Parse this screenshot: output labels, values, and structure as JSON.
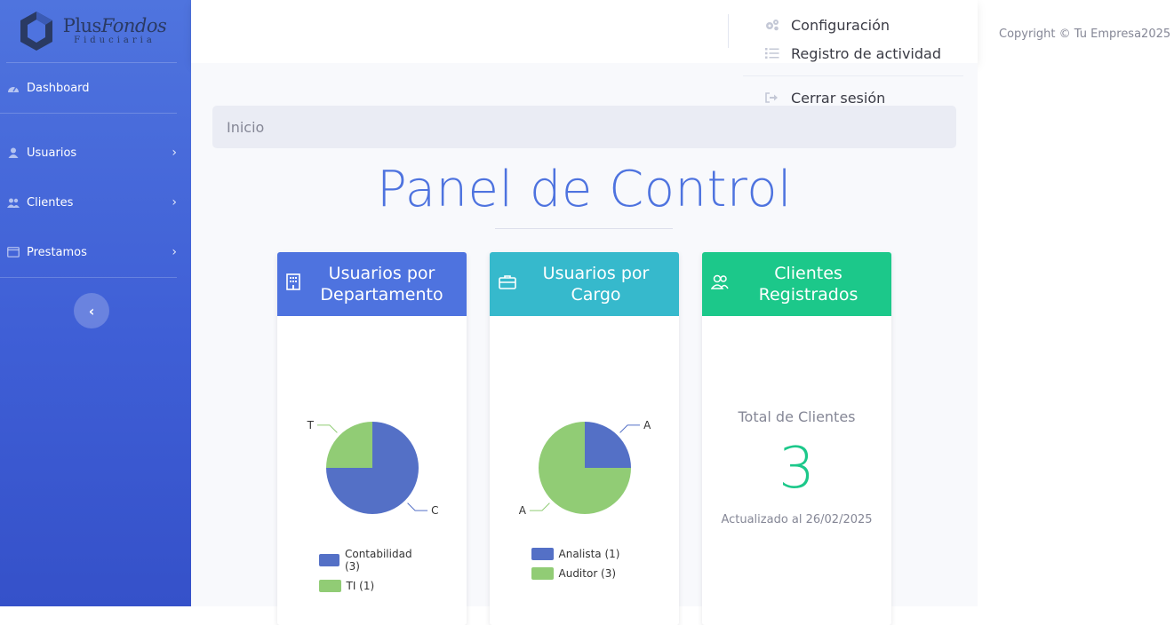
{
  "brand": {
    "name_plain": "Plus",
    "name_italic": "Fondos",
    "subtitle": "Fiduciaria"
  },
  "sidebar": {
    "dashboard": "Dashboard",
    "items": [
      {
        "label": "Usuarios",
        "icon": "user-icon"
      },
      {
        "label": "Clientes",
        "icon": "users-icon"
      },
      {
        "label": "Prestamos",
        "icon": "window-icon"
      }
    ]
  },
  "menu": {
    "config": "Configuración",
    "activity": "Registro de actividad",
    "logout": "Cerrar sesión"
  },
  "copyright": "Copyright © Tu Empresa2025",
  "breadcrumb": "Inicio",
  "page_title": "Panel de Control",
  "cards": {
    "dept": {
      "title": "Usuarios por Departamento",
      "color": "#4e73df"
    },
    "cargo": {
      "title": "Usuarios por Cargo",
      "color": "#36b9cc"
    },
    "clients": {
      "title": "Clientes Registrados",
      "color": "#1cc88a",
      "label": "Total de Clientes",
      "value": "3",
      "updated": "Actualizado al 26/02/2025"
    }
  },
  "chart_data": [
    {
      "type": "pie",
      "categories": [
        "Contabilidad",
        "TI"
      ],
      "values": [
        3,
        1
      ],
      "colors": [
        "#5470c6",
        "#91cc75"
      ],
      "slice_labels": [
        "C",
        "T"
      ],
      "legend": [
        "Contabilidad (3)",
        "TI (1)"
      ]
    },
    {
      "type": "pie",
      "categories": [
        "Analista",
        "Auditor"
      ],
      "values": [
        1,
        3
      ],
      "colors": [
        "#5470c6",
        "#91cc75"
      ],
      "slice_labels": [
        "A",
        "A"
      ],
      "legend": [
        "Analista (1)",
        "Auditor (3)"
      ]
    }
  ]
}
